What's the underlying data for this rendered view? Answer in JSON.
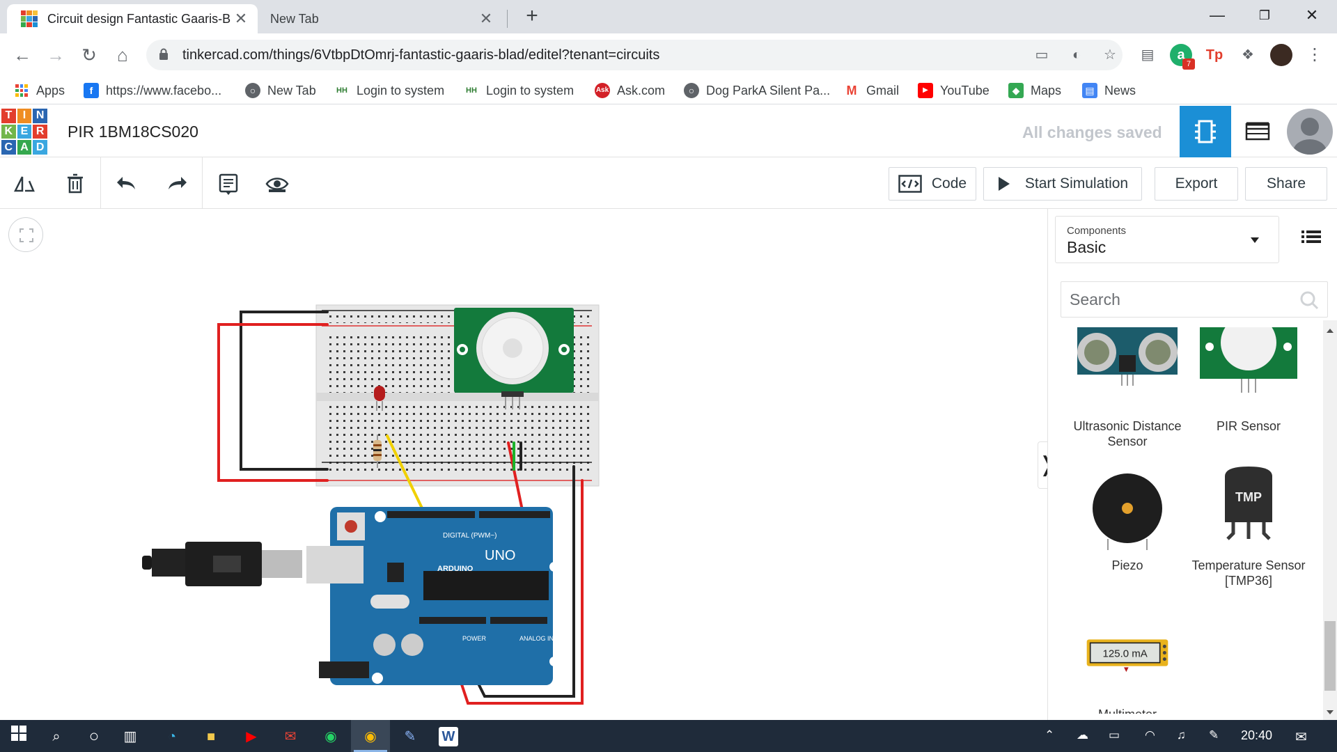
{
  "browser": {
    "tabs": [
      {
        "title": "Circuit design Fantastic Gaaris-Bl",
        "active": true
      },
      {
        "title": "New Tab",
        "active": false
      }
    ],
    "new_tab_symbol": "+",
    "url": "tinkercad.com/things/6VtbpDtOmrj-fantastic-gaaris-blad/editel?tenant=circuits",
    "extension_badge": "7",
    "bookmarks": [
      {
        "label": "Apps",
        "icon": "apps-grid-icon"
      },
      {
        "label": "https://www.facebo...",
        "icon": "facebook-icon"
      },
      {
        "label": "New Tab",
        "icon": "globe-icon"
      },
      {
        "label": "Login to system",
        "icon": "site-icon"
      },
      {
        "label": "Login to system",
        "icon": "site-icon"
      },
      {
        "label": "Ask.com",
        "icon": "ask-icon"
      },
      {
        "label": "Dog ParkA Silent Pa...",
        "icon": "globe-icon"
      },
      {
        "label": "Gmail",
        "icon": "gmail-icon"
      },
      {
        "label": "YouTube",
        "icon": "youtube-icon"
      },
      {
        "label": "Maps",
        "icon": "maps-icon"
      },
      {
        "label": "News",
        "icon": "news-icon"
      }
    ]
  },
  "tinkercad": {
    "logo_letters": [
      "T",
      "I",
      "N",
      "K",
      "E",
      "R",
      "C",
      "A",
      "D"
    ],
    "project_title": "PIR 1BM18CS020",
    "save_status": "All changes saved",
    "toolbar": {
      "code_label": "Code",
      "simulate_label": "Start Simulation",
      "export_label": "Export",
      "share_label": "Share"
    },
    "panel": {
      "components_label": "Components",
      "components_value": "Basic",
      "search_placeholder": "Search",
      "items": [
        {
          "name": "Ultrasonic Distance Sensor"
        },
        {
          "name": "PIR Sensor"
        },
        {
          "name": "Piezo"
        },
        {
          "name": "Temperature Sensor [TMP36]"
        },
        {
          "name": "Multimeter",
          "readout": "125.0 mA"
        }
      ]
    },
    "canvas": {
      "arduino_brand": "ARDUINO",
      "arduino_model": "UNO",
      "digital_label": "DIGITAL (PWM~)",
      "power_label": "POWER",
      "analog_label": "ANALOG IN",
      "tmp_label": "TMP"
    }
  },
  "taskbar": {
    "clock": "20:40"
  },
  "colors": {
    "tinkercad_blue": "#1b8fd6",
    "arduino_blue": "#1f6fa8",
    "pcb_green": "#137a3c",
    "wire_red": "#e02020",
    "wire_black": "#222222",
    "wire_yellow": "#f0d000",
    "taskbar": "#1f2b3a"
  }
}
